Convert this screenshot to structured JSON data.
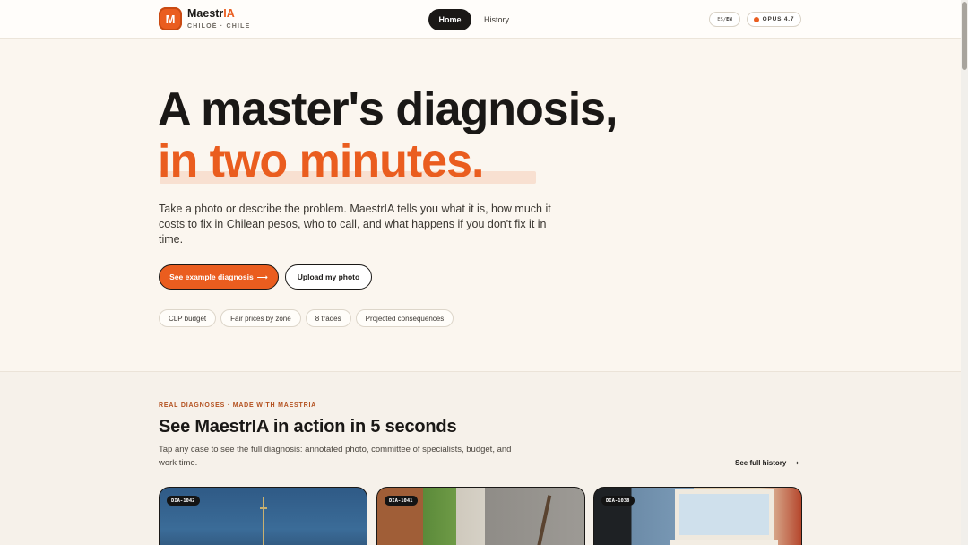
{
  "header": {
    "brand": {
      "logo_letter": "M",
      "name_prefix": "Maestr",
      "name_suffix": "IA",
      "location": "CHILOÉ · CHILE"
    },
    "nav": {
      "home": "Home",
      "history": "History"
    },
    "lang": {
      "es": "ES",
      "sep": " / ",
      "en": "EN"
    },
    "model_badge": "OPUS 4.7"
  },
  "hero": {
    "title_line1": "A master's diagnosis,",
    "title_line2": "in two minutes.",
    "lead": "Take a photo or describe the problem. MaestrIA tells you what it is, how much it costs to fix in Chilean pesos, who to call, and what happens if you don't fix it in time.",
    "primary_button": "See example diagnosis",
    "primary_arrow": "⟶",
    "secondary_button": "Upload my photo",
    "chips": [
      "CLP budget",
      "Fair prices by zone",
      "8 trades",
      "Projected consequences"
    ]
  },
  "showcase": {
    "eyebrow": "REAL DIAGNOSES · MADE WITH MAESTRIA",
    "title": "See MaestrIA in action in 5 seconds",
    "subtitle": "Tap any case to see the full diagnosis: annotated photo, committee of specialists, budget, and work time.",
    "see_all": "See full history ⟶",
    "cards": [
      {
        "id": "DIA-1042"
      },
      {
        "id": "DIA-1041"
      },
      {
        "id": "DIA-1038"
      }
    ]
  },
  "colors": {
    "accent": "#ea5d1f",
    "ink": "#1a1816",
    "background": "#faf6ef"
  }
}
